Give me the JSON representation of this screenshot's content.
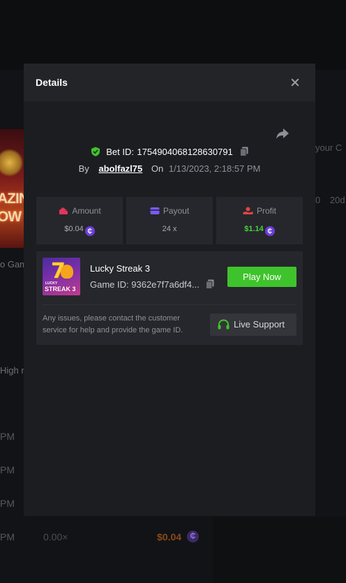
{
  "background": {
    "left_labels": [
      "o Gam",
      "High r"
    ],
    "banner_words": [
      "AZIN",
      "OW"
    ],
    "right_labels": [
      "your C",
      "0",
      "20d"
    ],
    "row_times": [
      "PM",
      "PM",
      "PM",
      "PM"
    ],
    "last_row": {
      "multiplier": "0.00×",
      "amount": "$0.04",
      "coin": "₵"
    }
  },
  "modal": {
    "title": "Details",
    "bet_label": "Bet ID:",
    "bet_id": "1754904068128630791",
    "by_label": "By",
    "username": "abolfazl75",
    "on_label": "On",
    "date": "1/13/2023, 2:18:57 PM",
    "stats": {
      "amount": {
        "label": "Amount",
        "value": "$0.04"
      },
      "payout": {
        "label": "Payout",
        "value": "24 x"
      },
      "profit": {
        "label": "Profit",
        "value": "$1.14"
      }
    },
    "coin_symbol": "₵",
    "game": {
      "name": "Lucky Streak 3",
      "id_label": "Game ID:",
      "id_value": "9362e7f7a6df4...",
      "thumb_line1": "LUCKY",
      "thumb_line2": "STREAK 3",
      "thumb_glyph": "7"
    },
    "play_button": "Play Now",
    "issue_text": "Any issues, please contact the customer service for help and provide the game ID.",
    "support_button": "Live Support"
  },
  "colors": {
    "accent_green": "#3fc32c",
    "profit_green": "#46d23a",
    "amount_icon": "#e2365a",
    "payout_icon": "#7a5cf0",
    "profit_icon": "#e24545",
    "coin_purple": "#6b3fd8"
  },
  "icons": [
    "close-icon",
    "share-icon",
    "shield-check-icon",
    "copy-icon",
    "amount-icon",
    "payout-icon",
    "profit-icon",
    "headset-icon"
  ]
}
